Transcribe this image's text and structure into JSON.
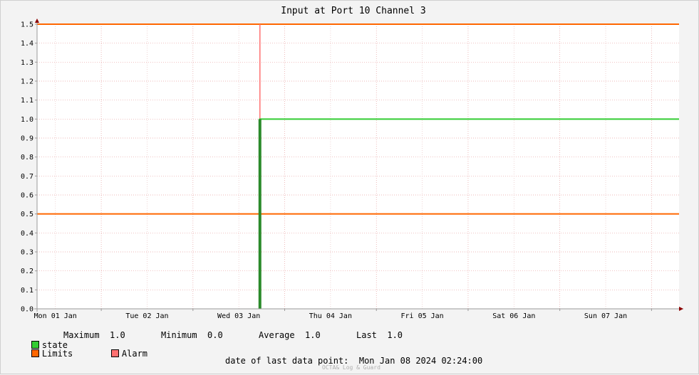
{
  "chart_data": {
    "type": "line",
    "title": "Input at Port 10 Channel 3",
    "ylim": [
      0,
      1.5
    ],
    "y_ticks": [
      0.0,
      0.1,
      0.2,
      0.3,
      0.4,
      0.5,
      0.6,
      0.7,
      0.8,
      0.9,
      1.0,
      1.1,
      1.2,
      1.3,
      1.4,
      1.5
    ],
    "x_tick_labels": [
      "Mon 01 Jan",
      "Tue 02 Jan",
      "Wed 03 Jan",
      "Thu 04 Jan",
      "Fri 05 Jan",
      "Sat 06 Jan",
      "Sun 07 Jan"
    ],
    "x_days_range": [
      -0.2,
      6.8
    ],
    "limits": [
      0.5,
      1.5
    ],
    "limit_color": "#ff6600",
    "alarm_at_day": 2.23,
    "alarm_color": "#ff7070",
    "series": [
      {
        "name": "state",
        "color": "#33cc33",
        "x_days": [
          2.23,
          2.23,
          6.8
        ],
        "values": [
          0.0,
          1.0,
          1.0
        ]
      }
    ],
    "grid": true
  },
  "legend": {
    "state_label": "state",
    "state_color": "#33cc33",
    "max_label": "Maximum",
    "max_value": "1.0",
    "min_label": "Minimum",
    "min_value": "0.0",
    "avg_label": "Average",
    "avg_value": "1.0",
    "last_label": "Last",
    "last_value": "1.0",
    "limits_label": "Limits",
    "limits_color": "#ff6600",
    "alarm_label": "Alarm",
    "alarm_color": "#ff7070"
  },
  "footer": {
    "last_point_label": "date of last data point:",
    "last_point_value": "Mon Jan 08 2024 02:24:00",
    "credit": "OCTA& Log & Guard"
  }
}
